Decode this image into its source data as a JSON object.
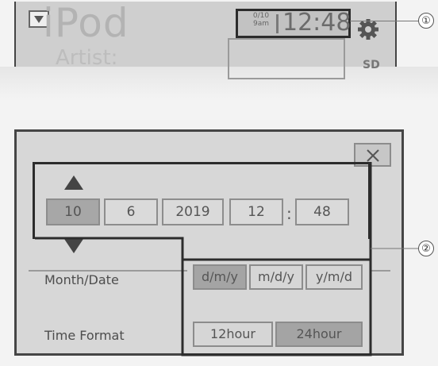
{
  "top_screen": {
    "source_title": "iPod",
    "sub_text": "Artist:",
    "clock_date_top": "0/10",
    "clock_date_bottom": "9am",
    "clock_time": "12:48",
    "side_mark": "SD"
  },
  "callouts": {
    "one": "①",
    "two": "②"
  },
  "date_time": {
    "month": "10",
    "day": "6",
    "year": "2019",
    "hour": "12",
    "minute": "48",
    "separator": ":"
  },
  "month_date": {
    "label": "Month/Date",
    "options": [
      "d/m/y",
      "m/d/y",
      "y/m/d"
    ],
    "selected": "d/m/y"
  },
  "time_format": {
    "label": "Time Format",
    "options": [
      "12hour",
      "24hour"
    ],
    "selected": "24hour"
  },
  "icons": {
    "close": "close-icon",
    "up": "arrow-up-icon",
    "down": "arrow-down-icon",
    "gear": "gear-icon",
    "dropdown": "chevron-down-icon"
  },
  "colors": {
    "frame": "#454545",
    "panel_bg": "#d7d7d7",
    "selected": "#a7a7a7"
  }
}
